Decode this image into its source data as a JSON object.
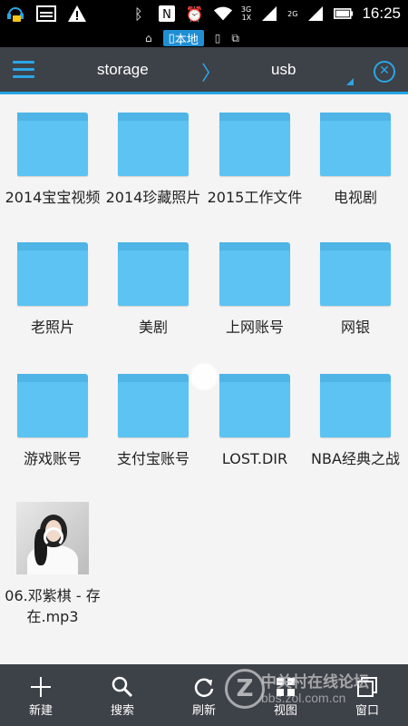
{
  "status_bar": {
    "time": "16:25",
    "network_top": "3G",
    "network_bottom": "1X",
    "network_secondary": "2G",
    "icons_left": [
      "headset-chat-icon",
      "image-icon",
      "warning-icon"
    ],
    "icons_right": [
      "bluetooth-icon",
      "nfc-icon",
      "alarm-icon",
      "wifi-icon",
      "signal-icon",
      "signal-icon",
      "battery-icon"
    ]
  },
  "view_switcher": {
    "items": [
      {
        "icon": "home-icon",
        "label": ""
      },
      {
        "icon": "phone-icon",
        "label": "本地"
      },
      {
        "icon": "phone-icon",
        "label": ""
      },
      {
        "icon": "network-icon",
        "label": ""
      }
    ]
  },
  "toolbar": {
    "crumbs": [
      "storage",
      "usb"
    ],
    "separator": "〉"
  },
  "files": [
    {
      "name": "2014宝宝视频",
      "type": "folder"
    },
    {
      "name": "2014珍藏照片",
      "type": "folder"
    },
    {
      "name": "2015工作文件",
      "type": "folder"
    },
    {
      "name": "电视剧",
      "type": "folder"
    },
    {
      "name": "老照片",
      "type": "folder"
    },
    {
      "name": "美剧",
      "type": "folder"
    },
    {
      "name": "上网账号",
      "type": "folder"
    },
    {
      "name": "网银",
      "type": "folder"
    },
    {
      "name": "游戏账号",
      "type": "folder"
    },
    {
      "name": "支付宝账号",
      "type": "folder"
    },
    {
      "name": "LOST.DIR",
      "type": "folder"
    },
    {
      "name": "NBA经典之战",
      "type": "folder"
    },
    {
      "name": "06.邓紫棋 - 存在.mp3",
      "type": "mp3"
    }
  ],
  "bottom_bar": [
    {
      "label": "新建",
      "icon": "plus-icon"
    },
    {
      "label": "搜索",
      "icon": "search-icon"
    },
    {
      "label": "刷新",
      "icon": "refresh-icon"
    },
    {
      "label": "视图",
      "icon": "grid-view-icon"
    },
    {
      "label": "窗口",
      "icon": "window-icon"
    }
  ],
  "watermark": {
    "line1": "中关村在线论坛",
    "line2": "bbs.zol.com.cn",
    "logo": "Z"
  },
  "colors": {
    "accent": "#2ba6e6",
    "folder": "#5cc3f2",
    "toolbar": "#3d4148",
    "background": "#f4f4f4"
  }
}
